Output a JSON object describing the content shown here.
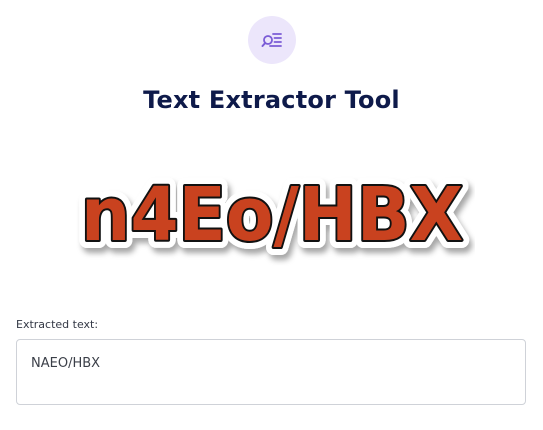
{
  "tool": {
    "icon": "text-search-icon",
    "accent_color": "#7b5cd6",
    "badge_color": "#ece6fb",
    "title": "Text Extractor Tool"
  },
  "image": {
    "captcha_text": "n4Eo/HBX",
    "fill_color": "#c9421f",
    "outline_color": "#111111"
  },
  "result": {
    "label": "Extracted text:",
    "value": "NAEO/HBX"
  }
}
